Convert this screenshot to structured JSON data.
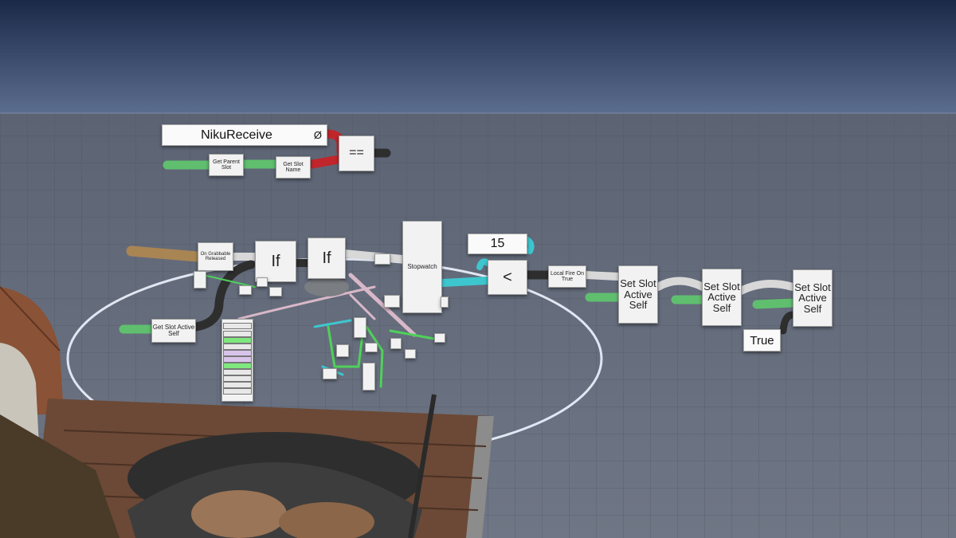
{
  "string_input": {
    "value": "NikuReceive",
    "null_symbol": "Ø"
  },
  "nodes": {
    "equals": "==",
    "get_parent_slot": "Get Parent Slot",
    "get_slot_name": "Get Slot Name",
    "on_grabbable_released": "On Grabbable Released",
    "if_1": "If",
    "if_2": "If",
    "stopwatch": "Stopwatch",
    "less_than": "<",
    "local_fire_on_true": "Local Fire On True",
    "set_slot_active_self_1": "Set Slot Active Self",
    "set_slot_active_self_2": "Set Slot Active Self",
    "set_slot_active_self_3": "Set Slot Active Self",
    "get_slot_active_self": "Get Slot Active Self",
    "true_value": "True"
  },
  "number_input": {
    "value": "15"
  },
  "colors": {
    "sky_top": "#1e2c4a",
    "sky_bottom": "#5a6c8c",
    "floor": "#5f6775",
    "string_wire": "#c0262b",
    "slot_wire": "#5fbf6f",
    "impulse_wire": "#d8d8d8",
    "float_wire": "#3ec6cf",
    "bool_wire": "#2e2e2e",
    "user_wire": "#a98554"
  }
}
